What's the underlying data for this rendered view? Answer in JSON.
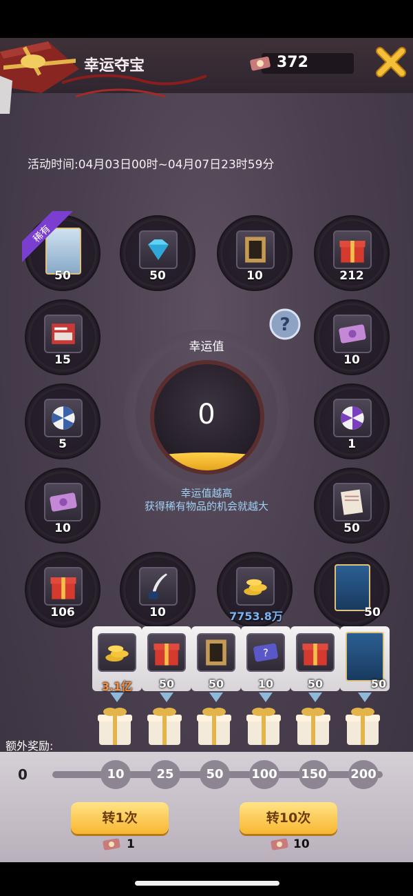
{
  "header": {
    "title": "幸运夺宝",
    "ticket_count": "372"
  },
  "activity_time": "活动时间:04月03日00时~04月07日23时59分",
  "rare_badge": "稀有",
  "luck": {
    "title": "幸运值",
    "value": "0",
    "fill_fraction": 0.17,
    "hint_line1": "幸运值越高",
    "hint_line2": "获得稀有物品的机会就越大"
  },
  "slots": [
    {
      "name": "hero-card",
      "qty": "50"
    },
    {
      "name": "diamond",
      "qty": "50"
    },
    {
      "name": "book",
      "qty": "10"
    },
    {
      "name": "gift-box-silver",
      "qty": "212"
    },
    {
      "name": "red-folder",
      "qty": "15"
    },
    {
      "name": "pink-ticket",
      "qty": "10"
    },
    {
      "name": "wheel-blue",
      "qty": "5"
    },
    {
      "name": "wheel-purple",
      "qty": "1"
    },
    {
      "name": "pink-ticket-2",
      "qty": "10"
    },
    {
      "name": "document",
      "qty": "50"
    },
    {
      "name": "gift-box-blue",
      "qty": "106"
    },
    {
      "name": "ink-quill",
      "qty": "10"
    },
    {
      "name": "gold-coins",
      "qty": ""
    },
    {
      "name": "agent-card",
      "qty": "50"
    }
  ],
  "highlight_value": "7753.8万",
  "bonus": [
    {
      "name": "gold-coins",
      "qty": "3.1亿"
    },
    {
      "name": "gift-box-silver",
      "qty": "50"
    },
    {
      "name": "book",
      "qty": "50"
    },
    {
      "name": "mystery-card",
      "qty": "10"
    },
    {
      "name": "gift-box-blue",
      "qty": "50"
    },
    {
      "name": "agent-card",
      "qty": "50"
    }
  ],
  "extra_reward_label": "额外奖励:",
  "progress": {
    "current": "0",
    "milestones": [
      "10",
      "25",
      "50",
      "100",
      "150",
      "200"
    ]
  },
  "buttons": {
    "spin_once": "转1次",
    "spin_ten": "转10次",
    "cost_once": "1",
    "cost_ten": "10"
  },
  "colors": {
    "accent": "#f8b731",
    "hint": "#9fd0f3",
    "highlight": "#7ab4f4"
  }
}
